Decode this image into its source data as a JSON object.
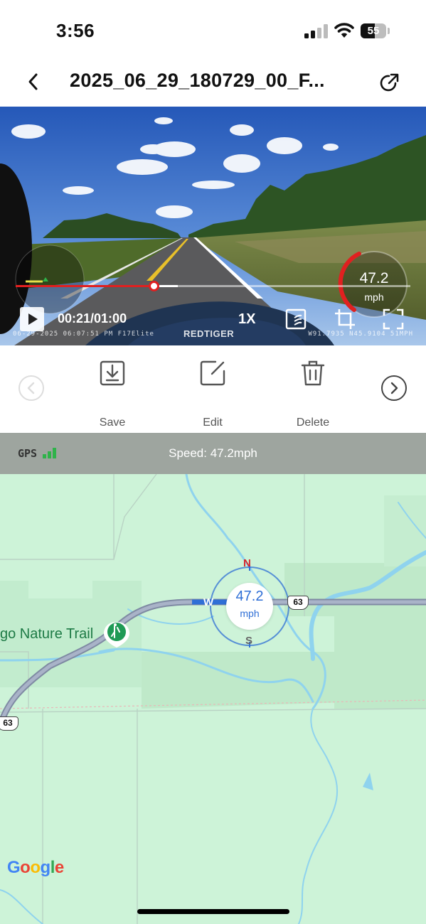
{
  "status_bar": {
    "time": "3:56",
    "battery": "55",
    "battery_fraction": 0.55
  },
  "header": {
    "title": "2025_06_29_180729_00_F...",
    "back_icon": "chevron-left-icon",
    "share_icon": "share-out-icon"
  },
  "player": {
    "elapsed_total": "00:21/01:00",
    "progress_fraction": 0.35,
    "buffered_fraction": 0.41,
    "playback_rate": "1X",
    "overlay_datetime": "06-29-2025 06:07:51 PM F17Elite",
    "overlay_coords": "W91.7935 N45.9104 51MPH",
    "brand": "REDTIGER",
    "gauge_speed": "47.2",
    "gauge_unit": "mph"
  },
  "actions": {
    "save": "Save",
    "edit": "Edit",
    "delete": "Delete"
  },
  "gps": {
    "label": "GPS",
    "speed_text": "Speed: 47.2mph"
  },
  "map": {
    "poi_label": "go Nature Trail",
    "compass_speed": "47.2",
    "compass_unit": "mph",
    "north": "N",
    "south": "S",
    "west": "W",
    "route_number": "63",
    "logo": "Google"
  },
  "colors": {
    "accent_red": "#e02020",
    "map_blue": "#2f6fd6",
    "map_green": "#cdf3d8",
    "gps_green": "#2fb34a"
  }
}
